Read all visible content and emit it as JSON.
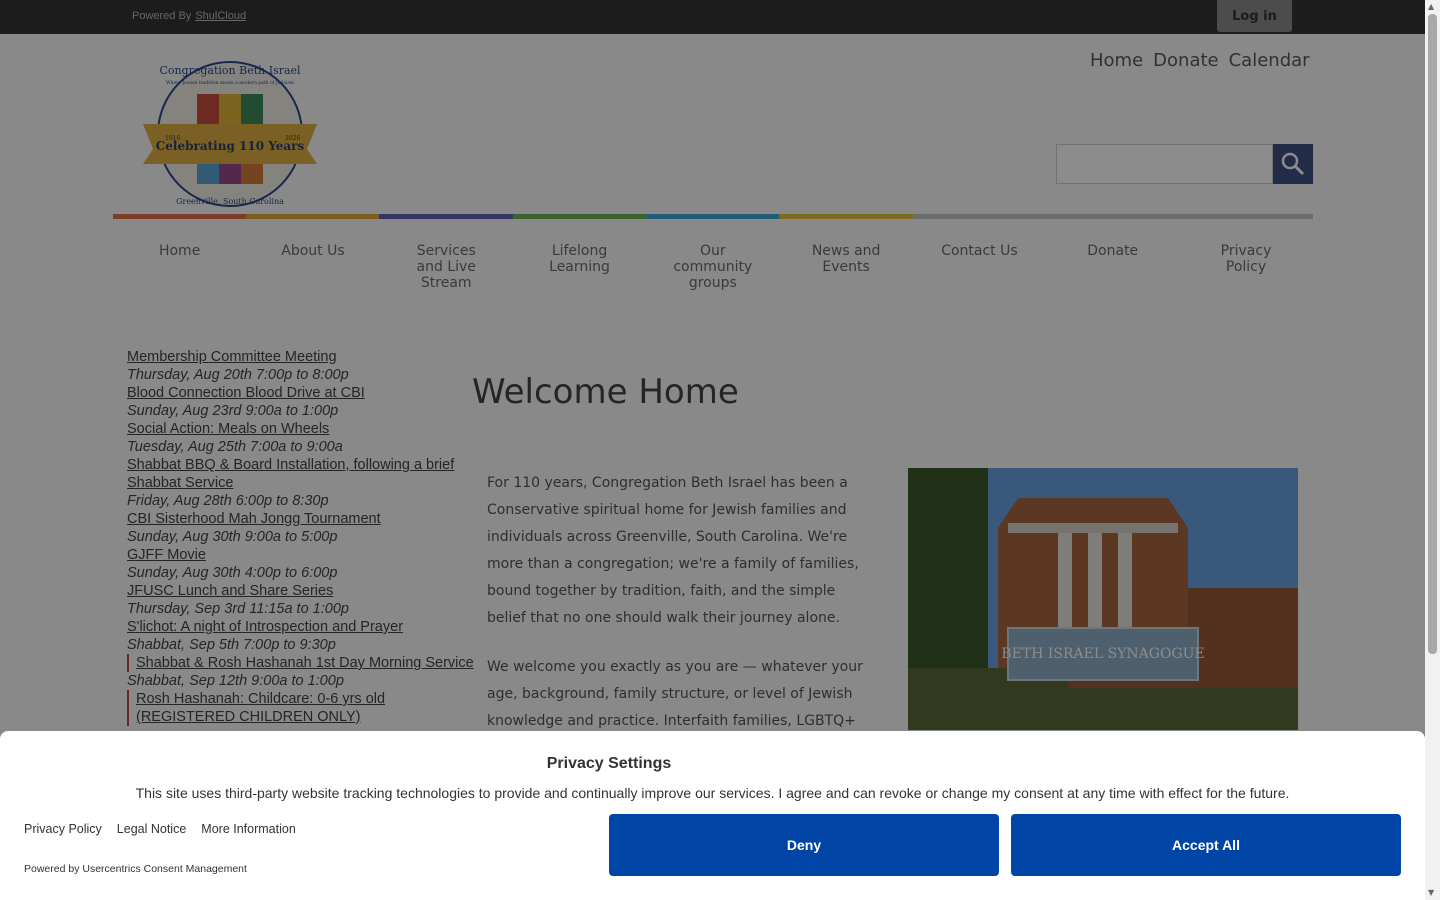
{
  "topbar": {
    "powered_by": "Powered By",
    "powered_link": "ShulCloud",
    "login": "Log in"
  },
  "utility_nav": [
    "Home",
    "Donate",
    "Calendar"
  ],
  "main_nav": [
    "Home",
    "About Us",
    "Services and Live Stream",
    "Lifelong Learning",
    "Our community groups",
    "News and Events",
    "Contact Us",
    "Donate",
    "Privacy Policy"
  ],
  "color_bar": [
    "#e0704a",
    "#e6a93a",
    "#5a67b6",
    "#6fb24e",
    "#3fa6d6",
    "#e6c13a",
    "#c6c6c6"
  ],
  "logo": {
    "name": "Congregation Beth Israel",
    "tagline": "Where Jewish tradition meets a modern path of Judaism",
    "banner": "Celebrating 110 Years",
    "year_start": "1916",
    "year_end": "2026",
    "location": "Greenville, South Carolina"
  },
  "events": [
    {
      "title": "Membership Committee Meeting",
      "date": "Thursday, Aug 20th 7:00p to 8:00p",
      "marked": false
    },
    {
      "title": "Blood Connection Blood Drive at CBI",
      "date": "Sunday, Aug 23rd 9:00a to 1:00p",
      "marked": false
    },
    {
      "title": "Social Action: Meals on Wheels",
      "date": "Tuesday, Aug 25th 7:00a to 9:00a",
      "marked": false
    },
    {
      "title": "Shabbat BBQ & Board Installation, following a brief Shabbat Service",
      "date": "Friday, Aug 28th 6:00p to 8:30p",
      "marked": false
    },
    {
      "title": "CBI Sisterhood Mah Jongg Tournament",
      "date": "Sunday, Aug 30th 9:00a to 5:00p",
      "marked": false
    },
    {
      "title": "GJFF Movie",
      "date": "Sunday, Aug 30th 4:00p to 6:00p",
      "marked": false
    },
    {
      "title": "JFUSC Lunch and Share Series",
      "date": "Thursday, Sep 3rd 11:15a to 1:00p",
      "marked": false
    },
    {
      "title": "S'lichot: A night of Introspection and Prayer",
      "date": "Shabbat, Sep 5th 7:00p to 9:30p",
      "marked": false
    },
    {
      "title": "Shabbat & Rosh Hashanah 1st Day Morning Service",
      "date": "Shabbat, Sep 12th 9:00a to 1:00p",
      "marked": true
    },
    {
      "title": "Rosh Hashanah: Childcare: 0-6 yrs old (REGISTERED CHILDREN ONLY)",
      "date": "",
      "marked": true
    }
  ],
  "main": {
    "heading": "Welcome Home",
    "p1": "For 110 years, Congregation Beth Israel has been a Conservative spiritual home for Jewish families and individuals across Greenville, South Carolina. We're more than a congregation; we're a family of families, bound together by tradition, faith, and the simple belief that no one should walk their journey alone.",
    "p2": "We welcome you exactly as you are — whatever your age, background, family structure, or level of Jewish knowledge and practice. Interfaith families, LGBTQ+",
    "photo_sign": "BETH ISRAEL SYNAGOGUE"
  },
  "consent": {
    "title": "Privacy Settings",
    "text": "This site uses third-party website tracking technologies to provide and continually improve our services. I agree and can revoke or change my consent at any time with effect for the future.",
    "links": [
      "Privacy Policy",
      "Legal Notice",
      "More Information"
    ],
    "powered": "Powered by Usercentrics Consent Management",
    "deny": "Deny",
    "accept": "Accept All"
  }
}
